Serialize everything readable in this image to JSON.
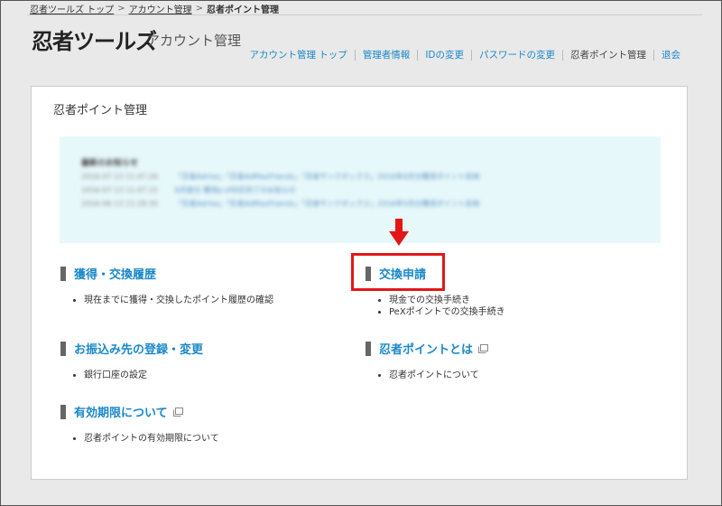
{
  "breadcrumb": {
    "items": [
      {
        "label": "忍者ツールズ トップ"
      },
      {
        "label": "アカウント管理"
      }
    ],
    "current": "忍者ポイント管理"
  },
  "header": {
    "logo": "忍者ツールズ",
    "subtitle": "アカウント管理"
  },
  "nav": {
    "items": [
      {
        "label": "アカウント管理 トップ",
        "current": false
      },
      {
        "label": "管理者情報",
        "current": false
      },
      {
        "label": "IDの変更",
        "current": false
      },
      {
        "label": "パスワードの変更",
        "current": false
      },
      {
        "label": "忍者ポイント管理",
        "current": true
      },
      {
        "label": "退会",
        "current": false
      }
    ]
  },
  "panel": {
    "title": "忍者ポイント管理"
  },
  "notice": {
    "heading": "最新のお知らせ",
    "rows": [
      {
        "date": "2016-07-13 11:47:26",
        "text": "「忍者Adrise」「忍者AdMaxFriends」「忍者サンクボックス」2016年6月分獲得ポイント反映"
      },
      {
        "date": "2016-07-13 11:47:15",
        "text": "6月度分 獲得p-sf対応完了のお知らせ"
      },
      {
        "date": "2016-06-13 11:28:30",
        "text": "「忍者Adrise」「忍者AdMaxFriends」「忍者サンクボックス」2016年5月分獲得ポイント反映"
      }
    ]
  },
  "sections": {
    "history": {
      "title": "獲得・交換履歴",
      "items": [
        "現在までに獲得・交換したポイント履歴の確認"
      ]
    },
    "exchange": {
      "title": "交換申請",
      "items": [
        "現金での交換手続き",
        "PeXポイントでの交換手続き"
      ]
    },
    "bank": {
      "title": "お振込み先の登録・変更",
      "items": [
        "銀行口座の設定"
      ]
    },
    "about": {
      "title": "忍者ポイントとは",
      "items": [
        "忍者ポイントについて"
      ]
    },
    "expiry": {
      "title": "有効期限について",
      "items": [
        "忍者ポイントの有効期限について"
      ]
    }
  },
  "annotation": {
    "color": "#e41717"
  },
  "colors": {
    "link": "#1a88c9",
    "notice_bg": "#e7f8fa"
  }
}
